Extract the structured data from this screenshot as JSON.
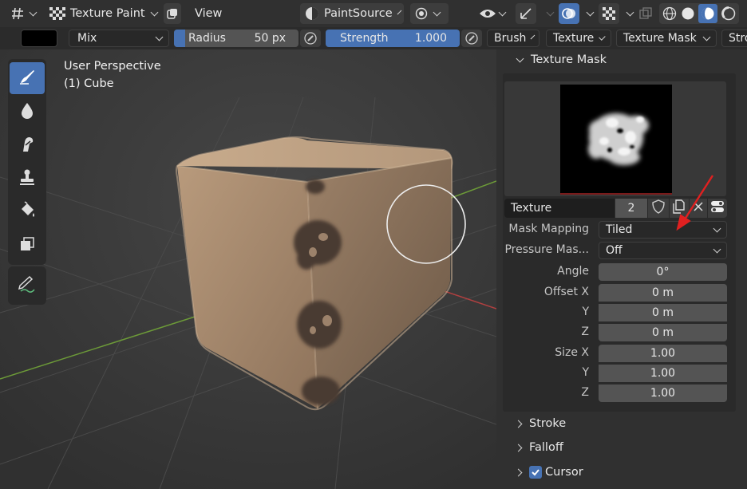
{
  "header": {
    "editor_type_icon": "grid-icon",
    "mode_label": "Texture Paint",
    "view_label": "View",
    "paint_source_label": "PaintSource"
  },
  "tool_settings": {
    "blend_mode": "Mix",
    "radius_label": "Radius",
    "radius_value": "50 px",
    "strength_label": "Strength",
    "strength_value": "1.000",
    "brush_label": "Brush",
    "texture_label": "Texture",
    "texture_mask_label": "Texture Mask",
    "stroke_label": "Stro"
  },
  "viewport": {
    "perspective_label": "User Perspective",
    "object_label": "(1) Cube"
  },
  "tools": [
    {
      "name": "draw-tool",
      "icon": "brush-icon",
      "active": true
    },
    {
      "name": "soften-tool",
      "icon": "drop-icon",
      "active": false
    },
    {
      "name": "smear-tool",
      "icon": "smear-icon",
      "active": false
    },
    {
      "name": "clone-tool",
      "icon": "stamp-icon",
      "active": false
    },
    {
      "name": "fill-tool",
      "icon": "bucket-icon",
      "active": false
    },
    {
      "name": "mask-tool",
      "icon": "mask-icon",
      "active": false
    }
  ],
  "panel": {
    "texture_mask_title": "Texture Mask",
    "texture_name": "Texture",
    "texture_users": "2",
    "mask_mapping_label": "Mask Mapping",
    "mask_mapping_value": "Tiled",
    "pressure_mask_label": "Pressure Mas...",
    "pressure_mask_value": "Off",
    "angle_label": "Angle",
    "angle_value": "0°",
    "offset_x_label": "Offset X",
    "offset_x_value": "0 m",
    "offset_y_label": "Y",
    "offset_y_value": "0 m",
    "offset_z_label": "Z",
    "offset_z_value": "0 m",
    "size_x_label": "Size X",
    "size_x_value": "1.00",
    "size_y_label": "Y",
    "size_y_value": "1.00",
    "size_z_label": "Z",
    "size_z_value": "1.00",
    "stroke_title": "Stroke",
    "falloff_title": "Falloff",
    "cursor_title": "Cursor"
  },
  "colors": {
    "accent": "#4772b3",
    "annotation_arrow": "#e02020"
  }
}
